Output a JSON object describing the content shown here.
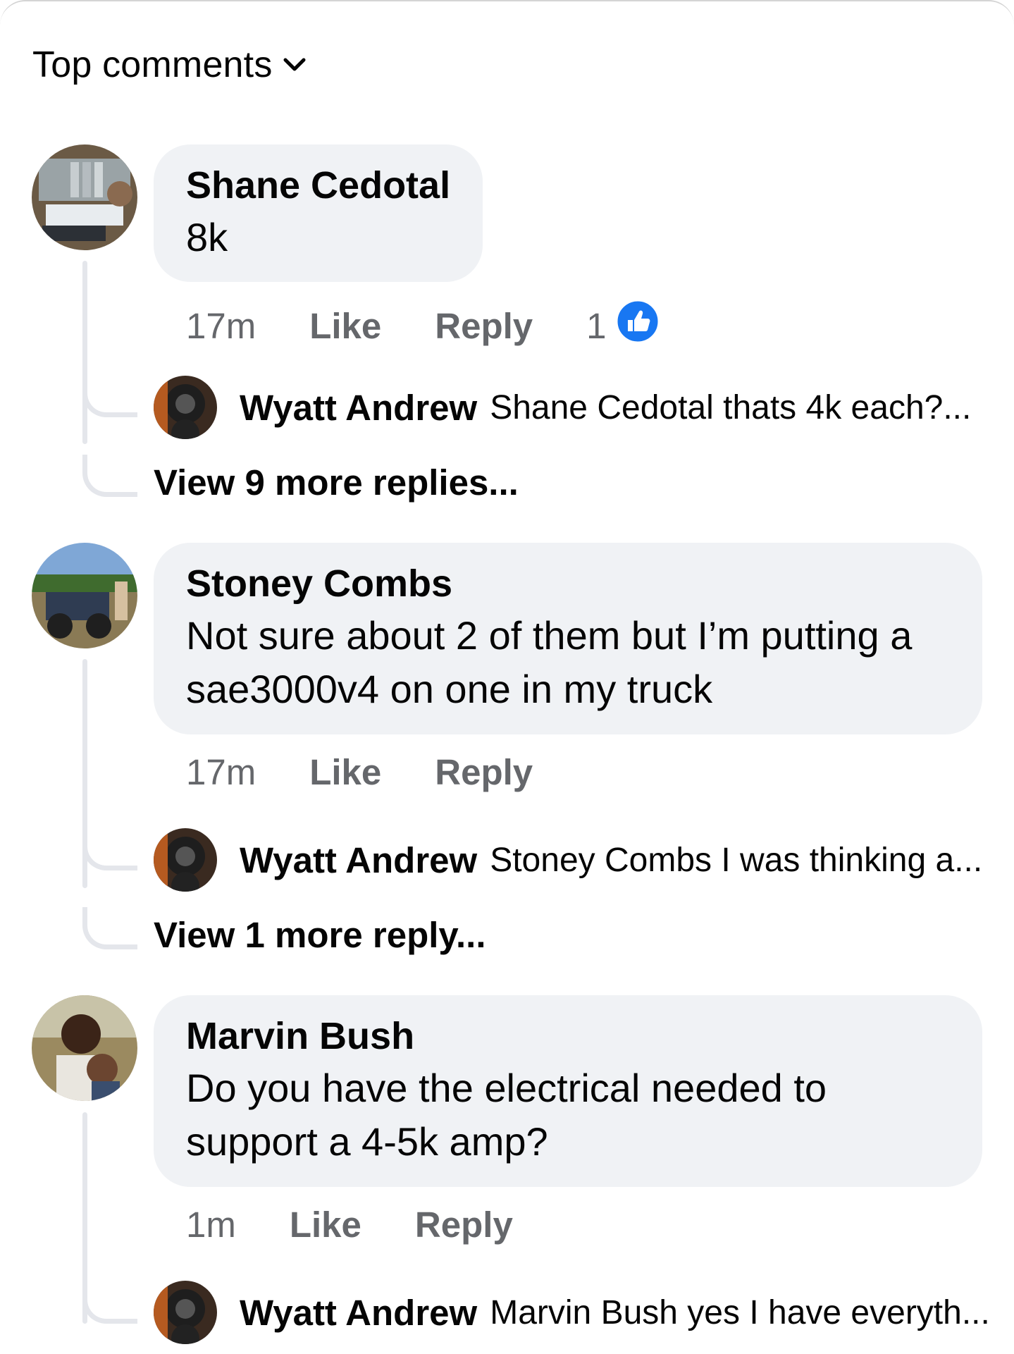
{
  "header": {
    "title": "Top comments"
  },
  "comments": [
    {
      "author": "Shane Cedotal",
      "text": "8k",
      "time": "17m",
      "like_label": "Like",
      "reply_label": "Reply",
      "reaction_count": "1",
      "reply": {
        "author": "Wyatt Andrew",
        "text": "Shane Cedotal thats 4k each?..."
      },
      "more_replies": "View 9 more replies..."
    },
    {
      "author": "Stoney Combs",
      "text": "Not sure about 2 of them but I’m putting a sae3000v4 on one in my truck",
      "time": "17m",
      "like_label": "Like",
      "reply_label": "Reply",
      "reply": {
        "author": "Wyatt Andrew",
        "text": "Stoney Combs I was thinking a..."
      },
      "more_replies": "View 1 more reply..."
    },
    {
      "author": "Marvin Bush",
      "text": "Do you have the electrical needed to support a 4-5k amp?",
      "time": "1m",
      "like_label": "Like",
      "reply_label": "Reply",
      "reply": {
        "author": "Wyatt Andrew",
        "text": "Marvin Bush yes I have everyth..."
      }
    }
  ],
  "colors": {
    "bubble": "#f0f2f5",
    "secondary_text": "#65676b",
    "like_blue": "#1877f2"
  }
}
